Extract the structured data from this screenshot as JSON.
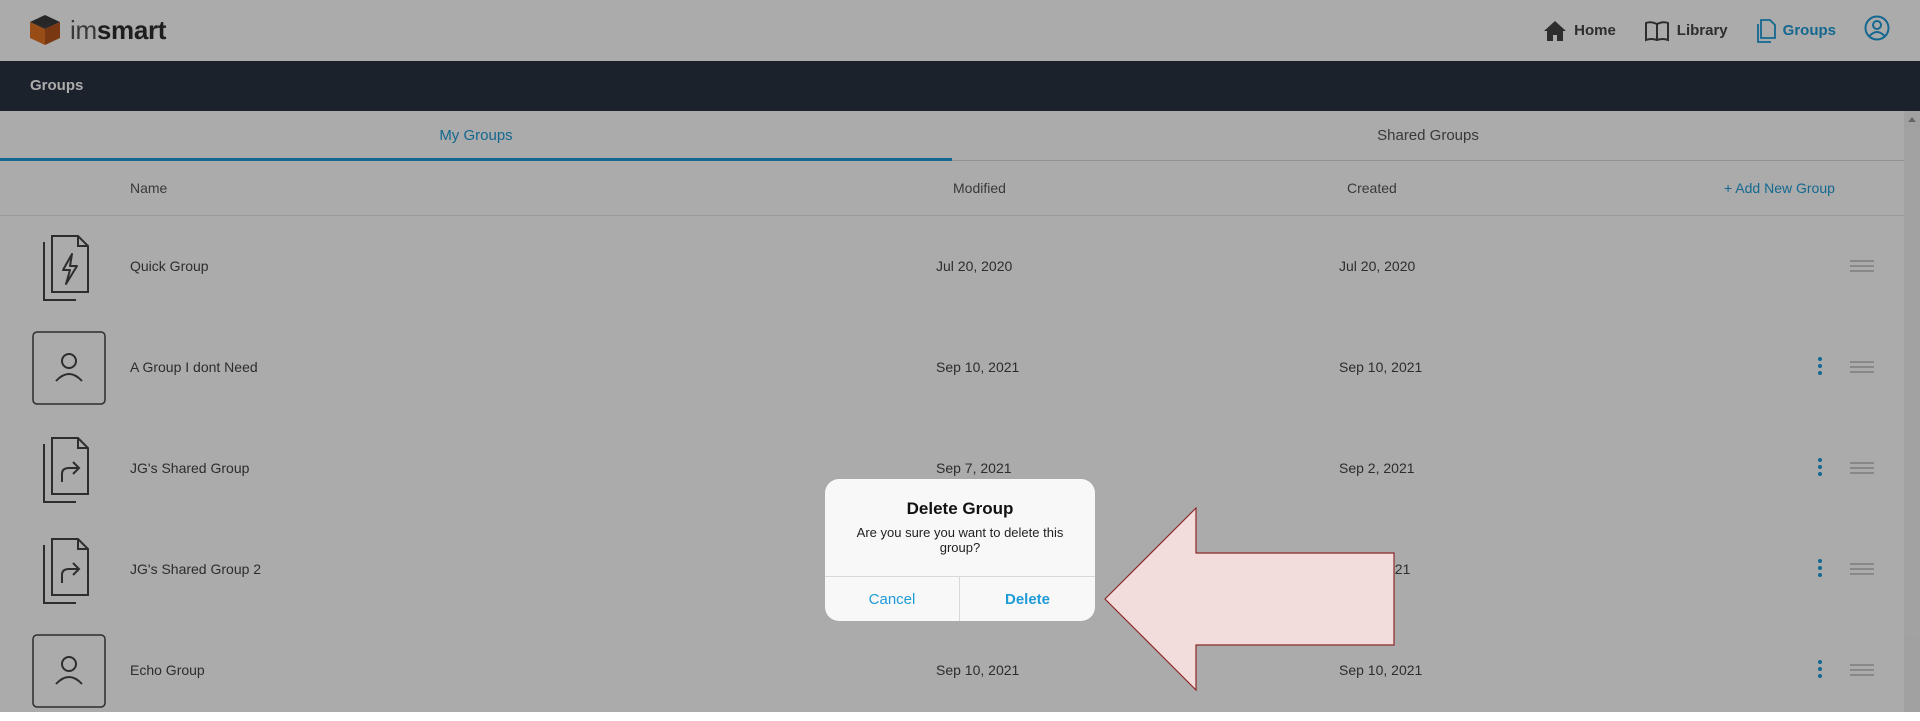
{
  "brand": {
    "name_light": "im",
    "name_bold": "smart"
  },
  "nav": {
    "items": [
      {
        "label": "Home",
        "icon": "home-icon"
      },
      {
        "label": "Library",
        "icon": "book-icon"
      },
      {
        "label": "Groups",
        "icon": "documents-icon",
        "active": true
      }
    ],
    "profile_icon": "user-circle-icon"
  },
  "section": {
    "title": "Groups"
  },
  "tabs": [
    {
      "label": "My Groups",
      "active": true
    },
    {
      "label": "Shared Groups",
      "active": false
    }
  ],
  "columns": {
    "name": "Name",
    "modified": "Modified",
    "created": "Created",
    "add": "+ Add New Group"
  },
  "rows": [
    {
      "name": "Quick Group",
      "modified": "Jul 20, 2020",
      "created": "Jul 20, 2020",
      "icon": "quick-group-icon",
      "menu": false
    },
    {
      "name": "A Group I dont Need",
      "modified": "Sep 10, 2021",
      "created": "Sep 10, 2021",
      "icon": "person-icon",
      "menu": true
    },
    {
      "name": "JG's Shared Group",
      "modified": "Sep 7, 2021",
      "created": "Sep 2, 2021",
      "icon": "shared-group-icon",
      "menu": true
    },
    {
      "name": "JG's Shared Group 2",
      "modified": "",
      "created": "021",
      "icon": "shared-group-icon",
      "menu": true
    },
    {
      "name": "Echo Group",
      "modified": "Sep 10, 2021",
      "created": "Sep 10, 2021",
      "icon": "person-icon",
      "menu": true
    }
  ],
  "dialog": {
    "title": "Delete Group",
    "message": "Are you sure you want to delete this group?",
    "cancel": "Cancel",
    "delete": "Delete"
  },
  "colors": {
    "accent": "#1e9bd7",
    "header_bar": "#2a3441",
    "annotation_arrow": "#f3dcdc"
  }
}
